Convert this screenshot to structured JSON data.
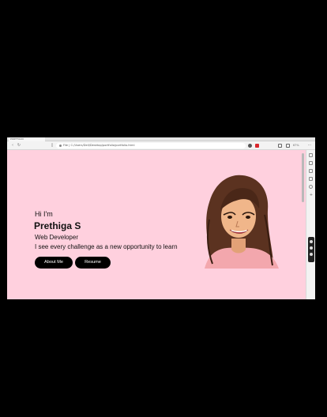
{
  "browser": {
    "tab_title": "PORTFOLIO",
    "url": "File | C:/Users/Dell/Desktop/portfolio/portfolio.html",
    "zoom": "67%"
  },
  "hero": {
    "greeting": "Hi I'm",
    "name": "Prethiga S",
    "role": "Web Developer",
    "tagline": "I see every challenge as a new opportunity to learn",
    "about_button": "About Me",
    "resume_button": "Resume"
  },
  "colors": {
    "page_background": "#ffd0de",
    "button_background": "#000000",
    "button_text": "#ffffff"
  },
  "icons": [
    "back-icon",
    "reload-icon",
    "info-icon",
    "extension-icon",
    "profile-icon",
    "menu-icon",
    "avatar-illustration"
  ]
}
